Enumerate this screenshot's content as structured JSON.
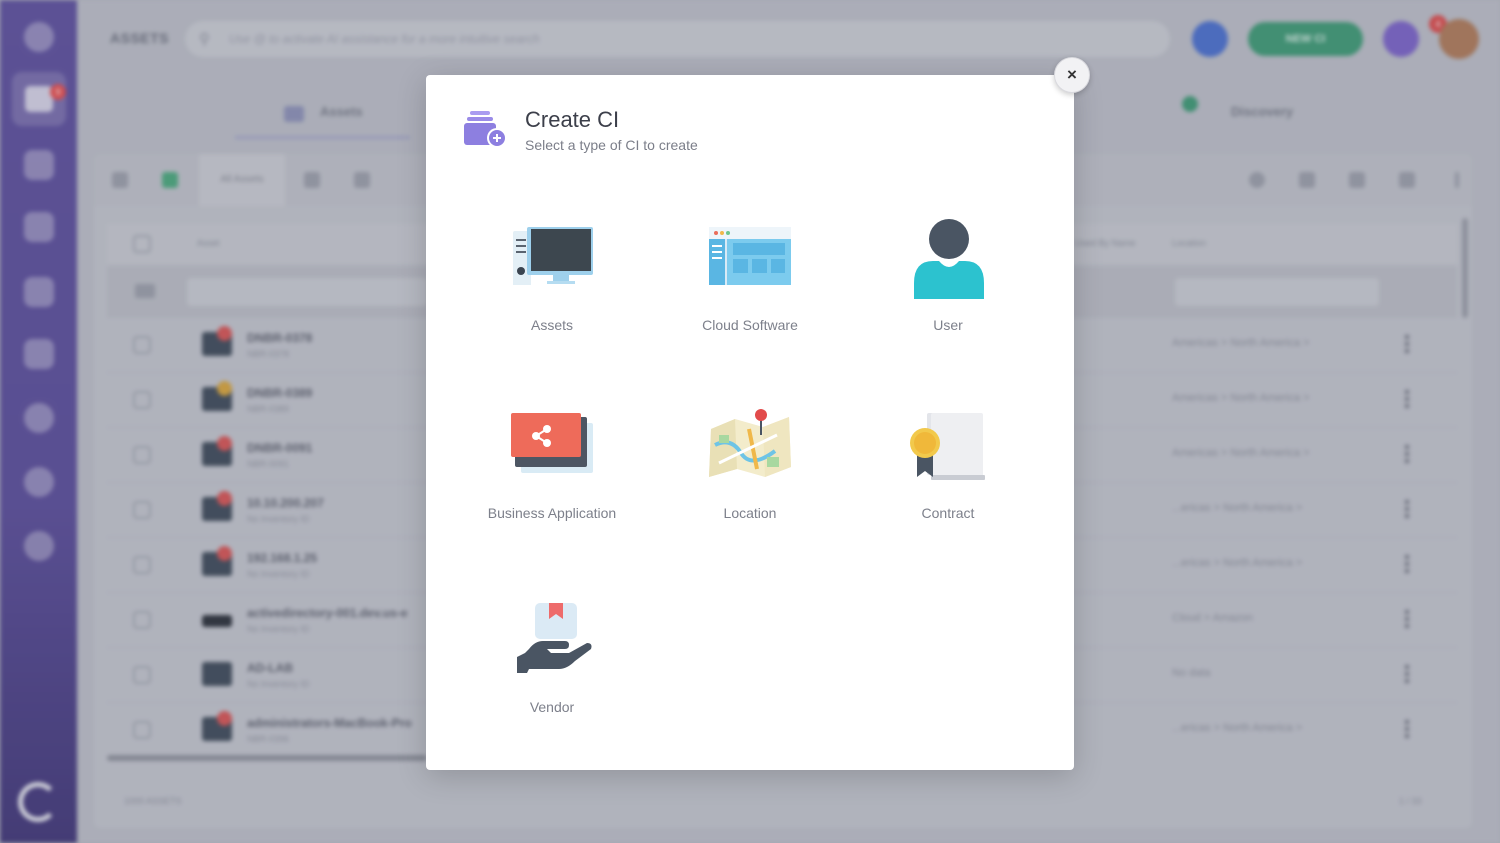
{
  "background": {
    "app_title": "ASSETS",
    "search_placeholder": "Use @ to activate AI assistance for a more intuitive search",
    "new_button": "NEW CI",
    "notif_badge": "4",
    "sidebar_badge": "9",
    "tabs": [
      {
        "label": "Assets"
      },
      {
        "label": "Discovery"
      }
    ],
    "toolbar_tab": "All Assets",
    "columns": {
      "asset": "Asset",
      "used_by": "Used By Name",
      "location": "Location"
    },
    "rows": [
      {
        "name": "DNBR-0378",
        "sub": "NBR-0378",
        "location": "Americas  >  North America  >"
      },
      {
        "name": "DNBR-0389",
        "sub": "NBR-0389",
        "location": "Americas  >  North America  >"
      },
      {
        "name": "DNBR-0091",
        "sub": "NBR-0091",
        "location": "Americas  >  North America  >"
      },
      {
        "name": "10.10.200.207",
        "sub": "No Inventory ID",
        "location": "...ericas  >  North America  >"
      },
      {
        "name": "192.168.1.25",
        "sub": "No Inventory ID",
        "location": "...ericas  >  North America  >"
      },
      {
        "name": "activedirectory-001.dev.us-e",
        "sub": "No Inventory ID",
        "location": "Cloud  >  Amazon"
      },
      {
        "name": "AD-LAB",
        "sub": "No Inventory ID",
        "location": "No data"
      },
      {
        "name": "administrators-MacBook-Pro",
        "sub": "NBR-0396",
        "location": "...ericas  >  North America  >"
      }
    ],
    "footer": "1000 ASSETS",
    "pagination": "1 / 33"
  },
  "modal": {
    "title": "Create CI",
    "subtitle": "Select a type of CI to create",
    "close_label": "×",
    "options": [
      {
        "label": "Assets",
        "icon": "monitor-icon"
      },
      {
        "label": "Cloud Software",
        "icon": "cloud-window-icon"
      },
      {
        "label": "User",
        "icon": "user-icon"
      },
      {
        "label": "Business Application",
        "icon": "share-app-icon"
      },
      {
        "label": "Location",
        "icon": "map-pin-icon"
      },
      {
        "label": "Contract",
        "icon": "certificate-icon"
      },
      {
        "label": "Vendor",
        "icon": "hand-box-icon"
      }
    ]
  },
  "colors": {
    "brand_purple": "#5d4f9e",
    "accent_purple": "#8d7fe0",
    "green_action": "#3d9a74",
    "teal": "#2ec3cf"
  }
}
